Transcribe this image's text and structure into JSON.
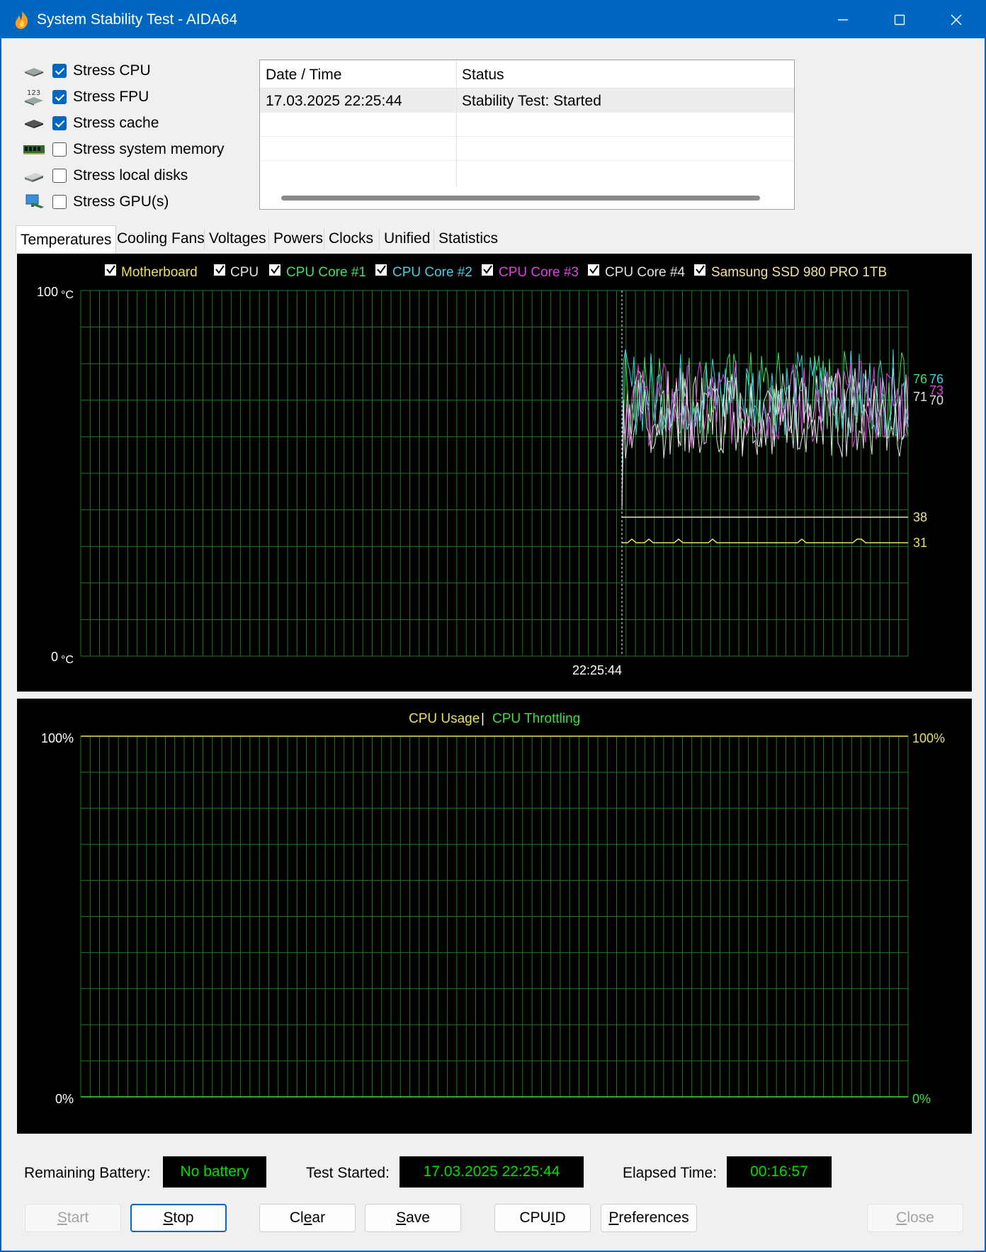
{
  "window": {
    "title": "System Stability Test - AIDA64",
    "icon": "flame-icon",
    "controls": [
      "minimize-icon",
      "maximize-icon",
      "close-icon"
    ]
  },
  "stress_options": [
    {
      "label": "Stress CPU",
      "checked": true,
      "icon": "cpu-chip-icon"
    },
    {
      "label": "Stress FPU",
      "checked": true,
      "icon": "fpu-123-icon"
    },
    {
      "label": "Stress cache",
      "checked": true,
      "icon": "cache-chip-icon"
    },
    {
      "label": "Stress system memory",
      "checked": false,
      "icon": "memory-module-icon"
    },
    {
      "label": "Stress local disks",
      "checked": false,
      "icon": "disk-drive-icon"
    },
    {
      "label": "Stress GPU(s)",
      "checked": false,
      "icon": "gpu-monitor-icon"
    }
  ],
  "log": {
    "headers": [
      "Date / Time",
      "Status"
    ],
    "rows": [
      [
        "17.03.2025 22:25:44",
        "Stability Test: Started"
      ]
    ]
  },
  "tabs": [
    "Temperatures",
    "Cooling Fans",
    "Voltages",
    "Powers",
    "Clocks",
    "Unified",
    "Statistics"
  ],
  "active_tab": "Temperatures",
  "colors": {
    "motherboard": "#e8e060",
    "cpu": "#e0e0e0",
    "core1": "#40e060",
    "core2": "#40d0e0",
    "core3": "#e040e0",
    "core4": "#e0e0e0",
    "ssd": "#f0e0a0",
    "grid": "#1e7a1e",
    "usage": "#e8e060",
    "throttling": "#40e040"
  },
  "temperature_chart": {
    "legend": [
      "Motherboard",
      "CPU",
      "CPU Core #1",
      "CPU Core #2",
      "CPU Core #3",
      "CPU Core #4",
      "Samsung SSD 980 PRO 1TB"
    ],
    "y_max_label": "100",
    "y_min_label": "0",
    "unit": "°C",
    "x_marker_label": "22:25:44",
    "end_values": [
      "76",
      "76",
      "73",
      "71",
      "70",
      "38",
      "31"
    ]
  },
  "usage_chart": {
    "legend_left": "CPU Usage",
    "separator": "|",
    "legend_right": "CPU Throttling",
    "left_max": "100%",
    "left_min": "0%",
    "right_max": "100%",
    "right_min": "0%"
  },
  "chart_data": [
    {
      "type": "line",
      "ylim": [
        0,
        100
      ],
      "x": [
        "22:25:44"
      ],
      "series": [
        {
          "name": "Motherboard",
          "values": [
            31
          ]
        },
        {
          "name": "CPU",
          "values": [
            71
          ]
        },
        {
          "name": "CPU Core #1",
          "values": [
            76
          ]
        },
        {
          "name": "CPU Core #2",
          "values": [
            76
          ]
        },
        {
          "name": "CPU Core #3",
          "values": [
            73
          ]
        },
        {
          "name": "CPU Core #4",
          "values": [
            70
          ]
        },
        {
          "name": "Samsung SSD 980 PRO 1TB",
          "values": [
            38
          ]
        }
      ]
    },
    {
      "type": "line",
      "ylim": [
        0,
        100
      ],
      "series": [
        {
          "name": "CPU Usage",
          "values": [
            100
          ]
        },
        {
          "name": "CPU Throttling",
          "values": [
            0
          ]
        }
      ]
    }
  ],
  "status": {
    "battery_label": "Remaining Battery:",
    "battery_value": "No battery",
    "started_label": "Test Started:",
    "started_value": "17.03.2025 22:25:44",
    "elapsed_label": "Elapsed Time:",
    "elapsed_value": "00:16:57"
  },
  "buttons": {
    "start": {
      "pre": "",
      "key": "S",
      "post": "tart"
    },
    "stop": {
      "pre": "",
      "key": "S",
      "post": "top"
    },
    "clear": {
      "pre": "Cl",
      "key": "e",
      "post": "ar"
    },
    "save": {
      "pre": "",
      "key": "S",
      "post": "ave"
    },
    "cpuid": {
      "pre": "CPU",
      "key": "I",
      "post": "D"
    },
    "preferences": {
      "pre": "",
      "key": "P",
      "post": "references"
    },
    "close": {
      "pre": "",
      "key": "C",
      "post": "lose"
    }
  }
}
